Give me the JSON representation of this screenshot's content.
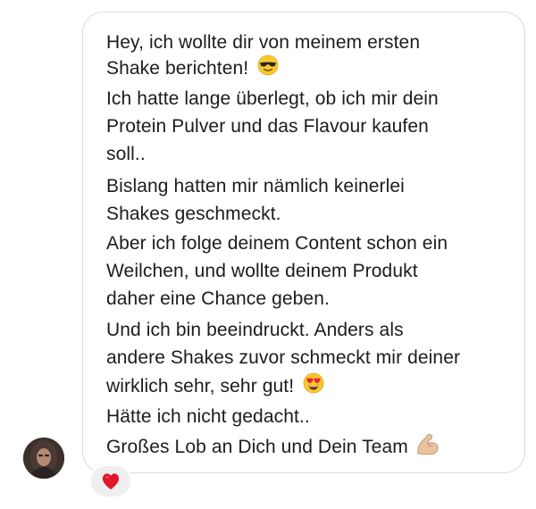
{
  "message": {
    "lines": [
      "Hey, ich wollte dir von meinem ersten",
      "Shake berichten!",
      "Ich hatte lange überlegt, ob ich mir dein",
      "Protein Pulver und das Flavour kaufen",
      "soll..",
      "Bislang hatten mir nämlich keinerlei",
      "Shakes geschmeckt.",
      "Aber ich folge deinem Content schon ein",
      "Weilchen, und wollte deinem Produkt",
      "daher eine Chance geben.",
      "Und ich bin beeindruckt. Anders als",
      "andere Shakes zuvor schmeckt mir deiner",
      "wirklich sehr, sehr gut!",
      "Hätte ich nicht gedacht..",
      "Großes Lob an Dich und Dein Team"
    ],
    "emojis": {
      "line_2": "sunglasses-emoji",
      "line_13": "heart-eyes-emoji",
      "line_15": "flexed-biceps-emoji"
    }
  },
  "sender": {
    "avatar": "avatar-photo"
  },
  "reaction": {
    "icon": "red-heart-icon",
    "color": "#e0182a"
  }
}
